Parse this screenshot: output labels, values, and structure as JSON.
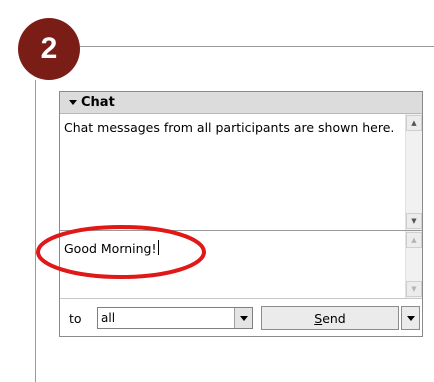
{
  "step": {
    "number": "2"
  },
  "chat": {
    "title": "Chat",
    "messages_text": "Chat messages from all participants are shown here.",
    "compose_value": "Good Morning!",
    "to_label": "to",
    "recipient": "all",
    "send_label_first": "S",
    "send_label_rest": "end"
  },
  "colors": {
    "badge": "#7a1d17",
    "highlight": "#e01818"
  }
}
